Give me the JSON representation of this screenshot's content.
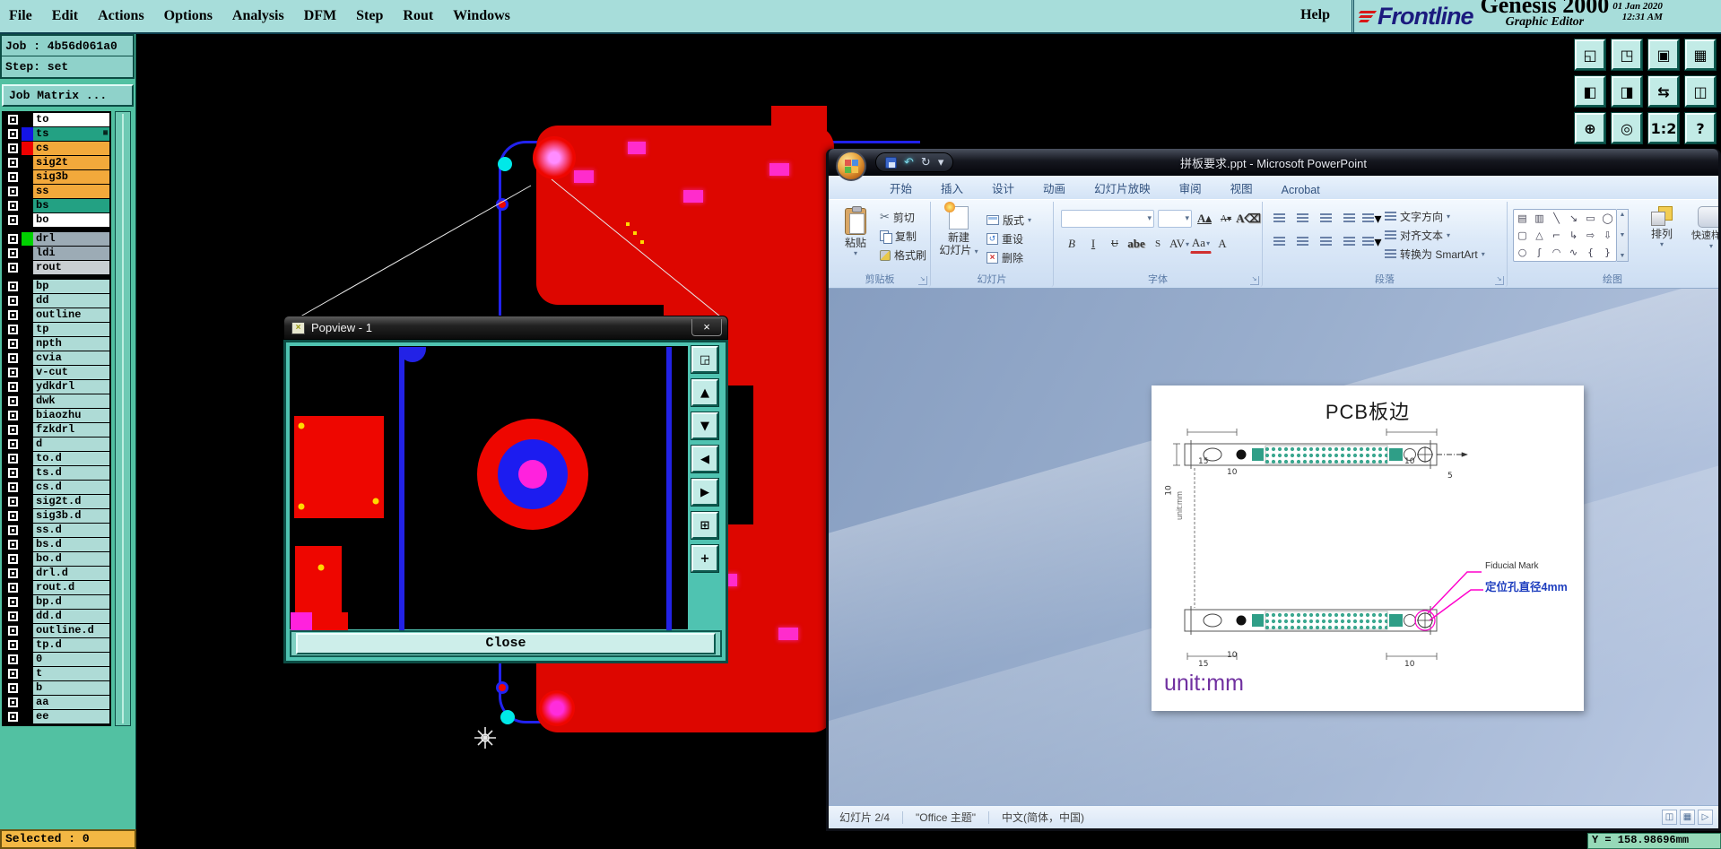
{
  "genesis": {
    "menu_items": [
      {
        "label": "File"
      },
      {
        "label": "Edit"
      },
      {
        "label": "Actions"
      },
      {
        "label": "Options"
      },
      {
        "label": "Analysis"
      },
      {
        "label": "DFM"
      },
      {
        "label": "Step"
      },
      {
        "label": "Rout"
      },
      {
        "label": "Windows"
      }
    ],
    "help_label": "Help",
    "brand": {
      "logo_text": "Frontline",
      "product": "Genesis 2000",
      "date": "01 Jan 2020",
      "time": "12:31 AM",
      "subtitle": "Graphic Editor"
    },
    "job_line": "Job : 4b56d061a0",
    "step_line": "Step: set",
    "job_matrix_label": "Job Matrix ...",
    "layers": [
      {
        "name": "to",
        "bg": "#ffffff",
        "swatch": "#000000"
      },
      {
        "name": "ts",
        "bg": "#23a183",
        "swatch": "#1414e6",
        "marker": "▦"
      },
      {
        "name": "cs",
        "bg": "#f2a93b",
        "swatch": "#ee0000"
      },
      {
        "name": "sig2t",
        "bg": "#f2a93b",
        "swatch": "#000000"
      },
      {
        "name": "sig3b",
        "bg": "#f2a93b",
        "swatch": "#000000"
      },
      {
        "name": "ss",
        "bg": "#f2a93b",
        "swatch": "#000000"
      },
      {
        "name": "bs",
        "bg": "#23a183",
        "swatch": "#000000"
      },
      {
        "name": "bo",
        "bg": "#ffffff",
        "swatch": "#000000"
      },
      {
        "name": "drl",
        "bg": "#9cabb5",
        "swatch": "#00d200",
        "mt": "5px"
      },
      {
        "name": "ldi",
        "bg": "#9cabb5",
        "swatch": "#000000"
      },
      {
        "name": "rout",
        "bg": "#c9ced2",
        "swatch": "#000000"
      },
      {
        "name": "bp",
        "bg": "#aedbd6",
        "swatch": "#000000",
        "mt": "5px"
      },
      {
        "name": "dd",
        "bg": "#aedbd6",
        "swatch": "#000000"
      },
      {
        "name": "outline",
        "bg": "#aedbd6",
        "swatch": "#000000"
      },
      {
        "name": "tp",
        "bg": "#aedbd6",
        "swatch": "#000000"
      },
      {
        "name": "npth",
        "bg": "#aedbd6",
        "swatch": "#000000"
      },
      {
        "name": "cvia",
        "bg": "#aedbd6",
        "swatch": "#000000"
      },
      {
        "name": "v-cut",
        "bg": "#aedbd6",
        "swatch": "#000000"
      },
      {
        "name": "ydkdrl",
        "bg": "#aedbd6",
        "swatch": "#000000"
      },
      {
        "name": "dwk",
        "bg": "#aedbd6",
        "swatch": "#000000"
      },
      {
        "name": "biaozhu",
        "bg": "#aedbd6",
        "swatch": "#000000"
      },
      {
        "name": "fzkdrl",
        "bg": "#aedbd6",
        "swatch": "#000000"
      },
      {
        "name": "d",
        "bg": "#aedbd6",
        "swatch": "#000000"
      },
      {
        "name": "to.d",
        "bg": "#aedbd6",
        "swatch": "#000000"
      },
      {
        "name": "ts.d",
        "bg": "#aedbd6",
        "swatch": "#000000"
      },
      {
        "name": "cs.d",
        "bg": "#aedbd6",
        "swatch": "#000000"
      },
      {
        "name": "sig2t.d",
        "bg": "#aedbd6",
        "swatch": "#000000"
      },
      {
        "name": "sig3b.d",
        "bg": "#aedbd6",
        "swatch": "#000000"
      },
      {
        "name": "ss.d",
        "bg": "#aedbd6",
        "swatch": "#000000"
      },
      {
        "name": "bs.d",
        "bg": "#aedbd6",
        "swatch": "#000000"
      },
      {
        "name": "bo.d",
        "bg": "#aedbd6",
        "swatch": "#000000"
      },
      {
        "name": "drl.d",
        "bg": "#aedbd6",
        "swatch": "#000000"
      },
      {
        "name": "rout.d",
        "bg": "#aedbd6",
        "swatch": "#000000"
      },
      {
        "name": "bp.d",
        "bg": "#aedbd6",
        "swatch": "#000000"
      },
      {
        "name": "dd.d",
        "bg": "#aedbd6",
        "swatch": "#000000"
      },
      {
        "name": "outline.d",
        "bg": "#aedbd6",
        "swatch": "#000000"
      },
      {
        "name": "tp.d",
        "bg": "#aedbd6",
        "swatch": "#000000"
      },
      {
        "name": "0",
        "bg": "#aedbd6",
        "swatch": "#000000"
      },
      {
        "name": "t",
        "bg": "#aedbd6",
        "swatch": "#000000"
      },
      {
        "name": "b",
        "bg": "#aedbd6",
        "swatch": "#000000"
      },
      {
        "name": "aa",
        "bg": "#aedbd6",
        "swatch": "#000000"
      },
      {
        "name": "ee",
        "bg": "#aedbd6",
        "swatch": "#000000"
      }
    ],
    "toolbar_buttons": [
      {
        "name": "zoom-window",
        "glyph": "◱"
      },
      {
        "name": "screen",
        "glyph": "◳"
      },
      {
        "name": "layers-window",
        "glyph": "▣"
      },
      {
        "name": "grid-window",
        "glyph": "▦"
      },
      {
        "name": "prev-view",
        "glyph": "◧"
      },
      {
        "name": "next-view",
        "glyph": "◨"
      },
      {
        "name": "swap-views",
        "glyph": "⇆"
      },
      {
        "name": "split-view",
        "glyph": "◫"
      },
      {
        "name": "zoom-fit",
        "glyph": "⊕"
      },
      {
        "name": "target",
        "glyph": "◎"
      },
      {
        "name": "ratio-1-2",
        "glyph": "1:2"
      },
      {
        "name": "help",
        "glyph": "?"
      }
    ],
    "selected_label": "Selected : 0",
    "coord_readout": "Y = 158.98696mm"
  },
  "popview": {
    "title": "Popview - 1",
    "close_x": "×",
    "close_label": "Close",
    "tools": [
      {
        "name": "pop-out",
        "glyph": "◲"
      },
      {
        "name": "pan-up",
        "glyph": "▲"
      },
      {
        "name": "pan-down",
        "glyph": "▼"
      },
      {
        "name": "pan-left",
        "glyph": "◀"
      },
      {
        "name": "pan-right",
        "glyph": "▶"
      },
      {
        "name": "zoom-extents",
        "glyph": "⊞"
      },
      {
        "name": "pan-center",
        "glyph": "+"
      }
    ]
  },
  "ppt": {
    "title": "拼板要求.ppt - Microsoft PowerPoint",
    "tabs": [
      {
        "label": "开始"
      },
      {
        "label": "插入"
      },
      {
        "label": "设计"
      },
      {
        "label": "动画"
      },
      {
        "label": "幻灯片放映"
      },
      {
        "label": "审阅"
      },
      {
        "label": "视图"
      },
      {
        "label": "Acrobat"
      }
    ],
    "clipboard": {
      "label": "剪贴板",
      "paste": "粘贴",
      "cut": "剪切",
      "copy": "复制",
      "format_painter": "格式刷"
    },
    "slides": {
      "label": "幻灯片",
      "new_slide_1": "新建",
      "new_slide_2": "幻灯片",
      "layout": "版式",
      "reset": "重设",
      "delete": "删除"
    },
    "font": {
      "label": "字体",
      "buttons": [
        {
          "label": "B"
        },
        {
          "label": "I"
        },
        {
          "label": "U"
        },
        {
          "label": "abe"
        },
        {
          "label": "S"
        },
        {
          "label": "AV"
        },
        {
          "label": "Aa"
        },
        {
          "label": "A"
        }
      ]
    },
    "paragraph": {
      "label": "段落",
      "text_direction": "文字方向",
      "align_text": "对齐文本",
      "smartart": "转换为 SmartArt"
    },
    "drawing": {
      "label": "绘图",
      "arrange": "排列",
      "quick_styles": "快速样式",
      "gallery": [
        {
          "glyph": "▤"
        },
        {
          "glyph": "▥"
        },
        {
          "glyph": "╲"
        },
        {
          "glyph": "↘"
        },
        {
          "glyph": "▭"
        },
        {
          "glyph": "◯"
        },
        {
          "glyph": "▢"
        },
        {
          "glyph": "△"
        },
        {
          "glyph": "⌐"
        },
        {
          "glyph": "↳"
        },
        {
          "glyph": "⇨"
        },
        {
          "glyph": "⇩"
        },
        {
          "glyph": "○"
        },
        {
          "glyph": "ʃ"
        },
        {
          "glyph": "◠"
        },
        {
          "glyph": "∿"
        },
        {
          "glyph": "{"
        },
        {
          "glyph": "}"
        }
      ]
    },
    "slide": {
      "title": "PCB板边",
      "fiducial_label": "Fiducial Mark",
      "hole_label": "定位孔直径4mm",
      "unit_label": "unit:mm",
      "side_note": "unit:mm",
      "dims": {
        "top_left_a": "15",
        "top_left_b": "10",
        "top_right": "10",
        "right_side": "5",
        "left_side": "10",
        "bottom_left": "15",
        "bottom_mid": "10",
        "bottom_right": "10"
      }
    },
    "status": {
      "slide_counter": "幻灯片 2/4",
      "theme": "\"Office 主题\"",
      "language": "中文(简体，中国)"
    }
  }
}
